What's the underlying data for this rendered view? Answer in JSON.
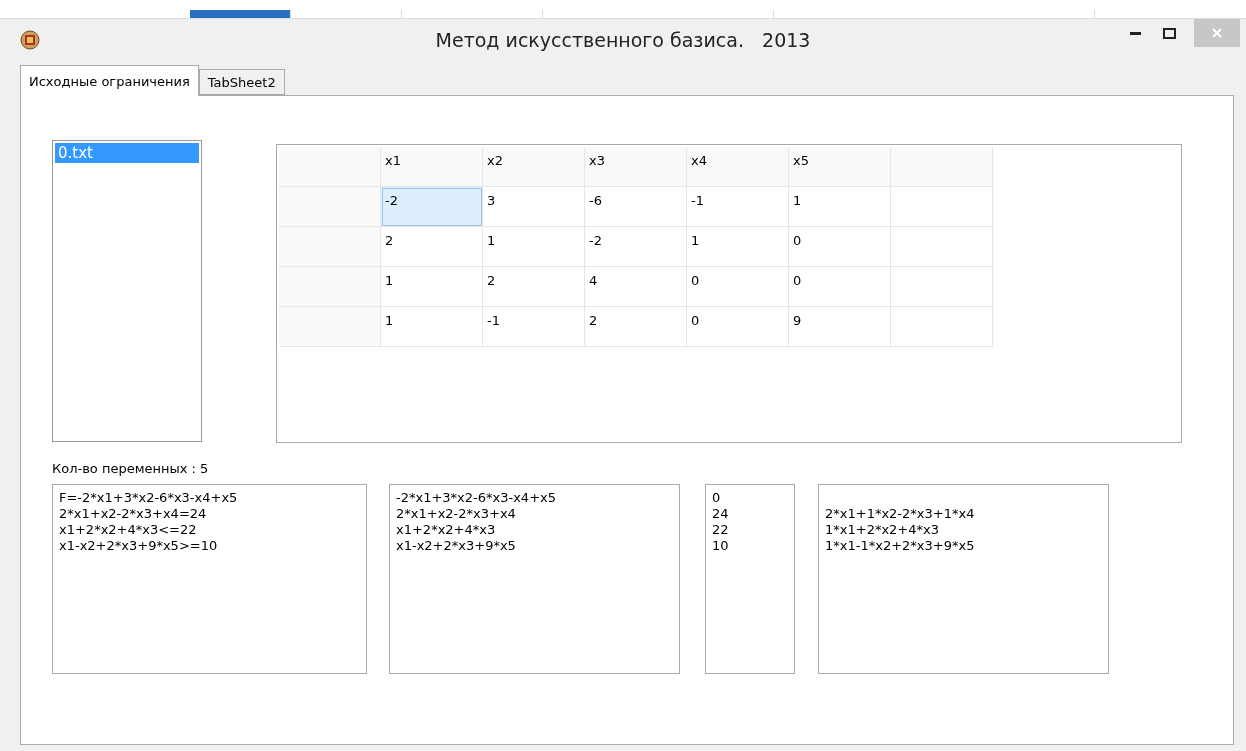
{
  "window": {
    "title": "Метод искусственного базиса.   2013"
  },
  "tabs": [
    {
      "label": "Исходные ограничения",
      "selected": true
    },
    {
      "label": "TabSheet2",
      "selected": false
    }
  ],
  "file_list": {
    "items": [
      {
        "label": "0.txt",
        "selected": true
      }
    ]
  },
  "grid": {
    "columns": [
      "x1",
      "x2",
      "x3",
      "x4",
      "x5"
    ],
    "rows": [
      [
        {
          "text": "-2",
          "selected": true
        },
        {
          "text": "3",
          "selected": false
        },
        {
          "text": "-6",
          "selected": false
        },
        {
          "text": "-1",
          "selected": false
        },
        {
          "text": "1",
          "selected": false
        }
      ],
      [
        {
          "text": "2",
          "selected": false
        },
        {
          "text": "1",
          "selected": false
        },
        {
          "text": "-2",
          "selected": false
        },
        {
          "text": "1",
          "selected": false
        },
        {
          "text": "0",
          "selected": false
        }
      ],
      [
        {
          "text": "1",
          "selected": false
        },
        {
          "text": "2",
          "selected": false
        },
        {
          "text": "4",
          "selected": false
        },
        {
          "text": "0",
          "selected": false
        },
        {
          "text": "0",
          "selected": false
        }
      ],
      [
        {
          "text": "1",
          "selected": false
        },
        {
          "text": "-1",
          "selected": false
        },
        {
          "text": "2",
          "selected": false
        },
        {
          "text": "0",
          "selected": false
        },
        {
          "text": "9",
          "selected": false
        }
      ]
    ]
  },
  "variable_count": "Кол-во переменных : 5",
  "memos": [
    {
      "blank_first_line": false,
      "lines": [
        "F=-2*x1+3*x2-6*x3-x4+x5",
        "2*x1+x2-2*x3+x4=24",
        "x1+2*x2+4*x3<=22",
        "x1-x2+2*x3+9*x5>=10"
      ]
    },
    {
      "blank_first_line": false,
      "lines": [
        "-2*x1+3*x2-6*x3-x4+x5",
        "2*x1+x2-2*x3+x4",
        "x1+2*x2+4*x3",
        "x1-x2+2*x3+9*x5"
      ]
    },
    {
      "blank_first_line": false,
      "lines": [
        "0",
        "24",
        "22",
        "10"
      ]
    },
    {
      "blank_first_line": true,
      "lines": [
        "2*x1+1*x2-2*x3+1*x4",
        "1*x1+2*x2+4*x3",
        "1*x1-1*x2+2*x3+9*x5"
      ]
    }
  ]
}
